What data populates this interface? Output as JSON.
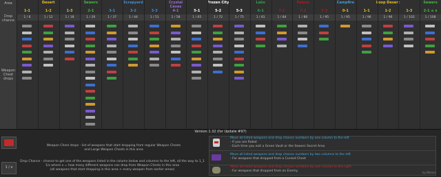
{
  "labels": {
    "area": "Area",
    "drop_chance": "Drop chance",
    "weapon_chest_drops": "Weapon Chest drops"
  },
  "areas": [
    {
      "name": "Desert",
      "color": "#e8c020"
    },
    {
      "name": "Sewers",
      "color": "#3fbf3f"
    },
    {
      "name": "Scrapyard",
      "color": "#3d8de0"
    },
    {
      "name": "Crystal Caves",
      "color": "#a06be0"
    },
    {
      "name": "Frozen City",
      "color": "#ffffff"
    },
    {
      "name": "Labs",
      "color": "#29a84a"
    },
    {
      "name": "Palace",
      "color": "#b01a1a"
    },
    {
      "name": "Campfire",
      "color": "#3aa0e0"
    },
    {
      "name": "Loop Desert",
      "color": "#e8c020"
    },
    {
      "name": "Sewers",
      "color": "#3fbf3f"
    }
  ],
  "zones": [
    "1-1",
    "1-2",
    "1-3",
    "2-1",
    "3-1",
    "3-2",
    "3-3",
    "4-1",
    "5-1",
    "5-2",
    "5-3",
    "6-1",
    "7-1",
    "7-2",
    "7-3",
    "0-1",
    "1-1",
    "1-2",
    "1-3",
    "2-1 ≤ x"
  ],
  "chances": [
    "1 / 6",
    "1 / 12",
    "1 / 18",
    "1 / 26",
    "1 / 37",
    "1 / 44",
    "1 / 51",
    "1 / 58",
    "1 / 65",
    "1 / 72",
    "1 / 75",
    "1 / 81",
    "1 / 84",
    "1 / 86",
    "1 / 95",
    "1 / 95",
    "1 / 96",
    "1 / 96",
    "1 / 102",
    "1 / 108"
  ],
  "version": "Version 1.32 (for Update #97)",
  "legend": {
    "chest_desc_1": "Weapon Chest drops - list of weapons that start dropping from regular Weapon Chests",
    "chest_desc_2": "and Large Weapon Chests in this area",
    "chance_desc_1": "Drop Chance - chance to get one of the weapons listed in the column below and columns to the left, all the way to 1_1",
    "chance_desc_2": "1/x where x = how many different weapons can drop from Weapon Chests in this area",
    "chance_desc_3": "(all weapons that start dropping in this area + every weapon from earlier areas)",
    "chance_icon_text": "1 / x"
  },
  "rules": [
    {
      "line1": "Move all listed weapons and drop chance numbers by one column to the left",
      "line1_color": "#3ab0e8",
      "line2": "- If you are Robot",
      "line3": "- Each time you exit a Green Vault or the Sewers Secret Area"
    },
    {
      "line1": "Move all listed weapons and drop chance numbers by two columns to the left",
      "line1_color": "#3ab0e8",
      "line2": "- For weapons that dropped from a Cursed Chest",
      "line3": ""
    },
    {
      "line1": "Move all listed weapons and drop chance numbers by one column to the right",
      "line1_color": "#d02a2a",
      "line2": "- For weapons that dropped from an Enemy",
      "line3": ""
    }
  ],
  "credit": "by Bleron",
  "colors": {
    "bg": "#303030",
    "panel": "#262626"
  }
}
